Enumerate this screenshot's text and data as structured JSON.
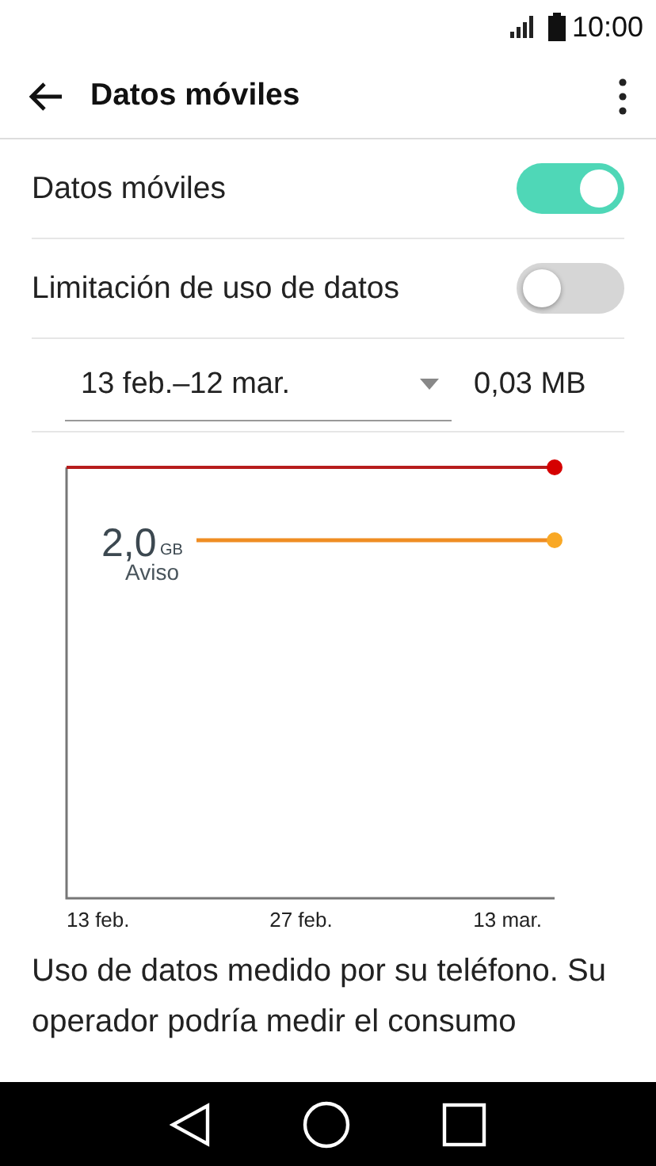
{
  "status_bar": {
    "time": "10:00"
  },
  "toolbar": {
    "title": "Datos móviles"
  },
  "settings": [
    {
      "label": "Datos móviles",
      "on": true
    },
    {
      "label": "Limitación de uso de datos",
      "on": false
    }
  ],
  "cycle": {
    "value": "13 feb.–12 mar.",
    "usage": "0,03 MB"
  },
  "chart": {
    "warning_value": "2,0",
    "warning_unit": "GB",
    "warning_label": "Aviso",
    "x_labels": [
      "13 feb.",
      "27 feb.",
      "13 mar."
    ]
  },
  "description": "Uso de datos medido por su teléfono. Su operador podría medir el consumo"
}
